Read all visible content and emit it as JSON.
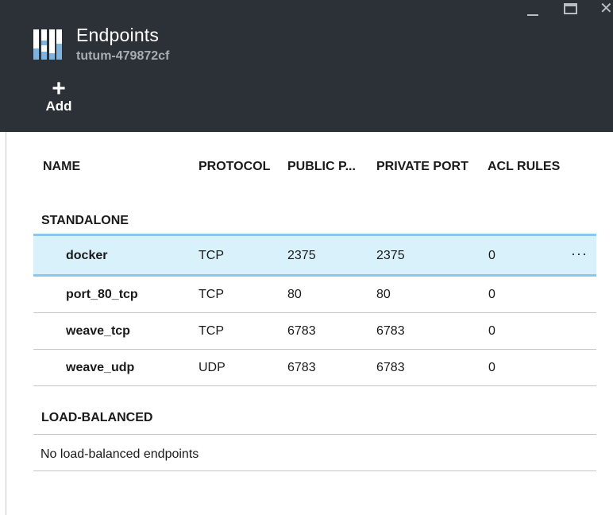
{
  "header": {
    "title": "Endpoints",
    "subtitle": "tutum-479872cf",
    "add_label": "Add",
    "add_glyph": "+",
    "close_glyph": "✕"
  },
  "columns": {
    "name": "NAME",
    "protocol": "PROTOCOL",
    "public_port": "PUBLIC P...",
    "private_port": "PRIVATE PORT",
    "acl_rules": "ACL RULES"
  },
  "sections": {
    "standalone": "STANDALONE",
    "load_balanced": "LOAD-BALANCED",
    "load_balanced_empty": "No load-balanced endpoints"
  },
  "endpoints": [
    {
      "name": "docker",
      "protocol": "TCP",
      "public_port": "2375",
      "private_port": "2375",
      "acl_rules": "0",
      "more": "···"
    },
    {
      "name": "port_80_tcp",
      "protocol": "TCP",
      "public_port": "80",
      "private_port": "80",
      "acl_rules": "0"
    },
    {
      "name": "weave_tcp",
      "protocol": "TCP",
      "public_port": "6783",
      "private_port": "6783",
      "acl_rules": "0"
    },
    {
      "name": "weave_udp",
      "protocol": "UDP",
      "public_port": "6783",
      "private_port": "6783",
      "acl_rules": "0"
    }
  ],
  "colors": {
    "header_bg": "#2b3137",
    "selected_row_bg": "#d9f1fb",
    "selected_row_border": "#8cc6ec"
  },
  "icons": [
    "endpoints-blade-icon",
    "plus-icon",
    "minimize-icon",
    "maximize-icon",
    "close-icon",
    "more-options-icon"
  ]
}
